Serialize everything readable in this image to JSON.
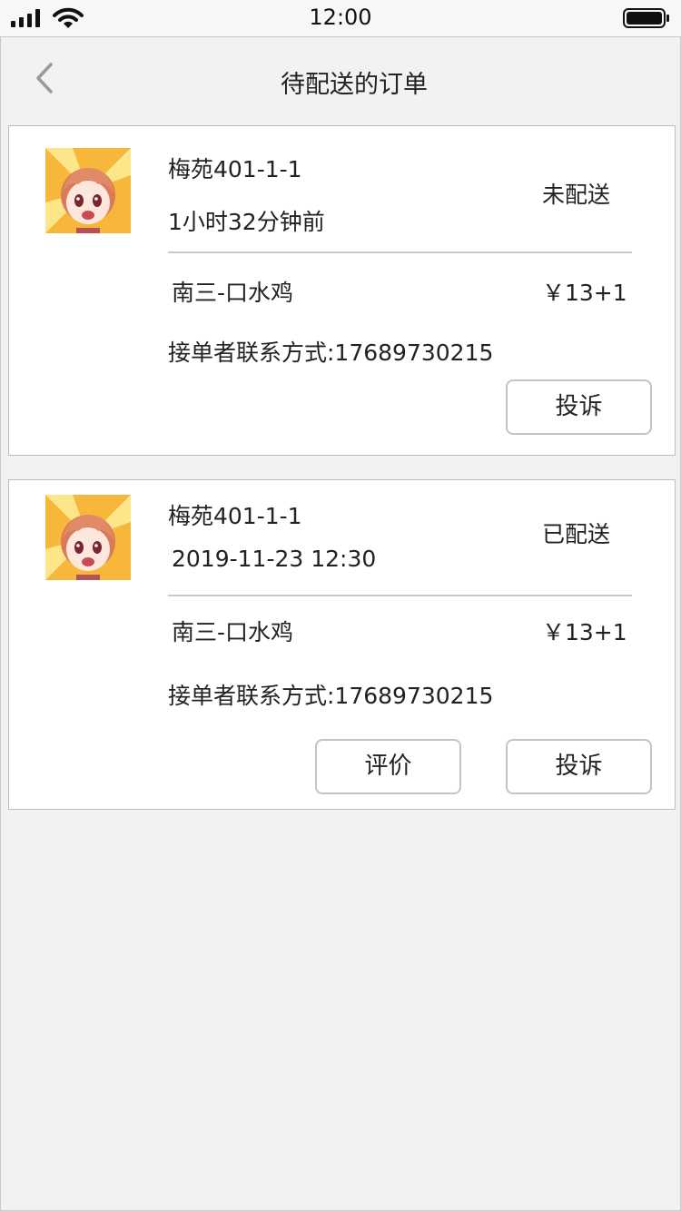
{
  "status_bar": {
    "time": "12:00"
  },
  "nav": {
    "title": "待配送的订单",
    "back_icon": "chevron-left-icon"
  },
  "orders": [
    {
      "address": "梅苑401-1-1",
      "time": "1小时32分钟前",
      "status": "未配送",
      "dish": "南三-口水鸡",
      "price": "￥13+1",
      "contact": "接单者联系方式:17689730215",
      "buttons": {
        "complain": "投诉"
      }
    },
    {
      "address": "梅苑401-1-1",
      "time": "2019-11-23 12:30",
      "status": "已配送",
      "dish": "南三-口水鸡",
      "price": "￥13+1",
      "contact": "接单者联系方式:17689730215",
      "buttons": {
        "review": "评价",
        "complain": "投诉"
      }
    }
  ],
  "colors": {
    "background": "#f2f2f2",
    "card_border": "#bdbdbd",
    "button_border": "#c4c4c4",
    "back_icon": "#9a9a9a"
  }
}
